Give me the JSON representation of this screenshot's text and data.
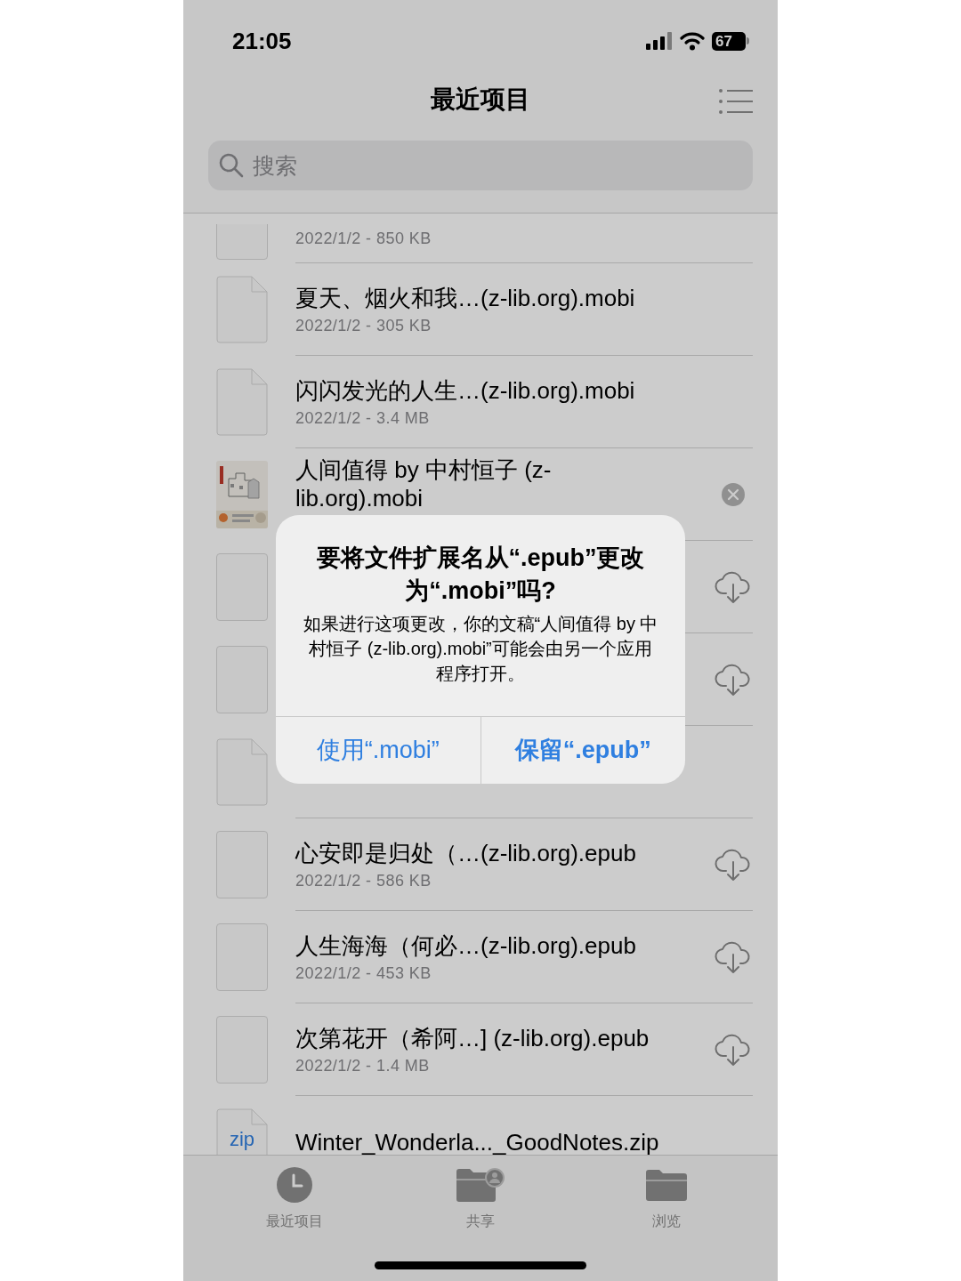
{
  "status_bar": {
    "time": "21:05",
    "battery": "67"
  },
  "nav": {
    "title": "最近项目"
  },
  "search": {
    "placeholder": "搜索"
  },
  "rows": [
    {
      "thumbnail": {
        "kind": "blank"
      },
      "meta": "2022/1/2 - 850 KB"
    },
    {
      "thumbnail": {
        "kind": "page"
      },
      "title": "夏天、烟火和我…(z-lib.org).mobi",
      "meta": "2022/1/2 - 305 KB"
    },
    {
      "thumbnail": {
        "kind": "page"
      },
      "title": "闪闪发光的人生…(z-lib.org).mobi",
      "meta": "2022/1/2 - 3.4 MB"
    },
    {
      "thumbnail": {
        "kind": "cover"
      },
      "title": "人间值得 by 中村恒子 (z-lib.org).mobi",
      "trailing": {
        "kind": "cancel"
      }
    },
    {
      "thumbnail": {
        "kind": "blank"
      },
      "trailing": {
        "kind": "cloud"
      }
    },
    {
      "thumbnail": {
        "kind": "blank"
      },
      "trailing": {
        "kind": "cloud"
      }
    },
    {
      "thumbnail": {
        "kind": "page"
      }
    },
    {
      "thumbnail": {
        "kind": "blank"
      },
      "title": "心安即是归处（…(z-lib.org).epub",
      "meta": "2022/1/2 - 586 KB",
      "trailing": {
        "kind": "cloud"
      }
    },
    {
      "thumbnail": {
        "kind": "blank"
      },
      "title": "人生海海（何必…(z-lib.org).epub",
      "meta": "2022/1/2 - 453 KB",
      "trailing": {
        "kind": "cloud"
      }
    },
    {
      "thumbnail": {
        "kind": "blank"
      },
      "title": "次第花开（希阿…] (z-lib.org).epub",
      "meta": "2022/1/2 - 1.4 MB",
      "trailing": {
        "kind": "cloud"
      }
    },
    {
      "thumbnail": {
        "kind": "zip",
        "label": "zip"
      },
      "title": "Winter_Wonderla..._GoodNotes.zip"
    }
  ],
  "dialog": {
    "title": "要将文件扩展名从“.epub”更改为“.mobi”吗?",
    "message": "如果进行这项更改，你的文稿“人间值得 by 中村恒子 (z-lib.org).mobi”可能会由另一个应用程序打开。",
    "buttons": [
      {
        "label": "使用“.mobi”",
        "bold": false
      },
      {
        "label": "保留“.epub”",
        "bold": true
      }
    ]
  },
  "tabs": [
    {
      "kind": "clock",
      "label": "最近项目"
    },
    {
      "kind": "shared",
      "label": "共享"
    },
    {
      "kind": "folder",
      "label": "浏览"
    }
  ]
}
